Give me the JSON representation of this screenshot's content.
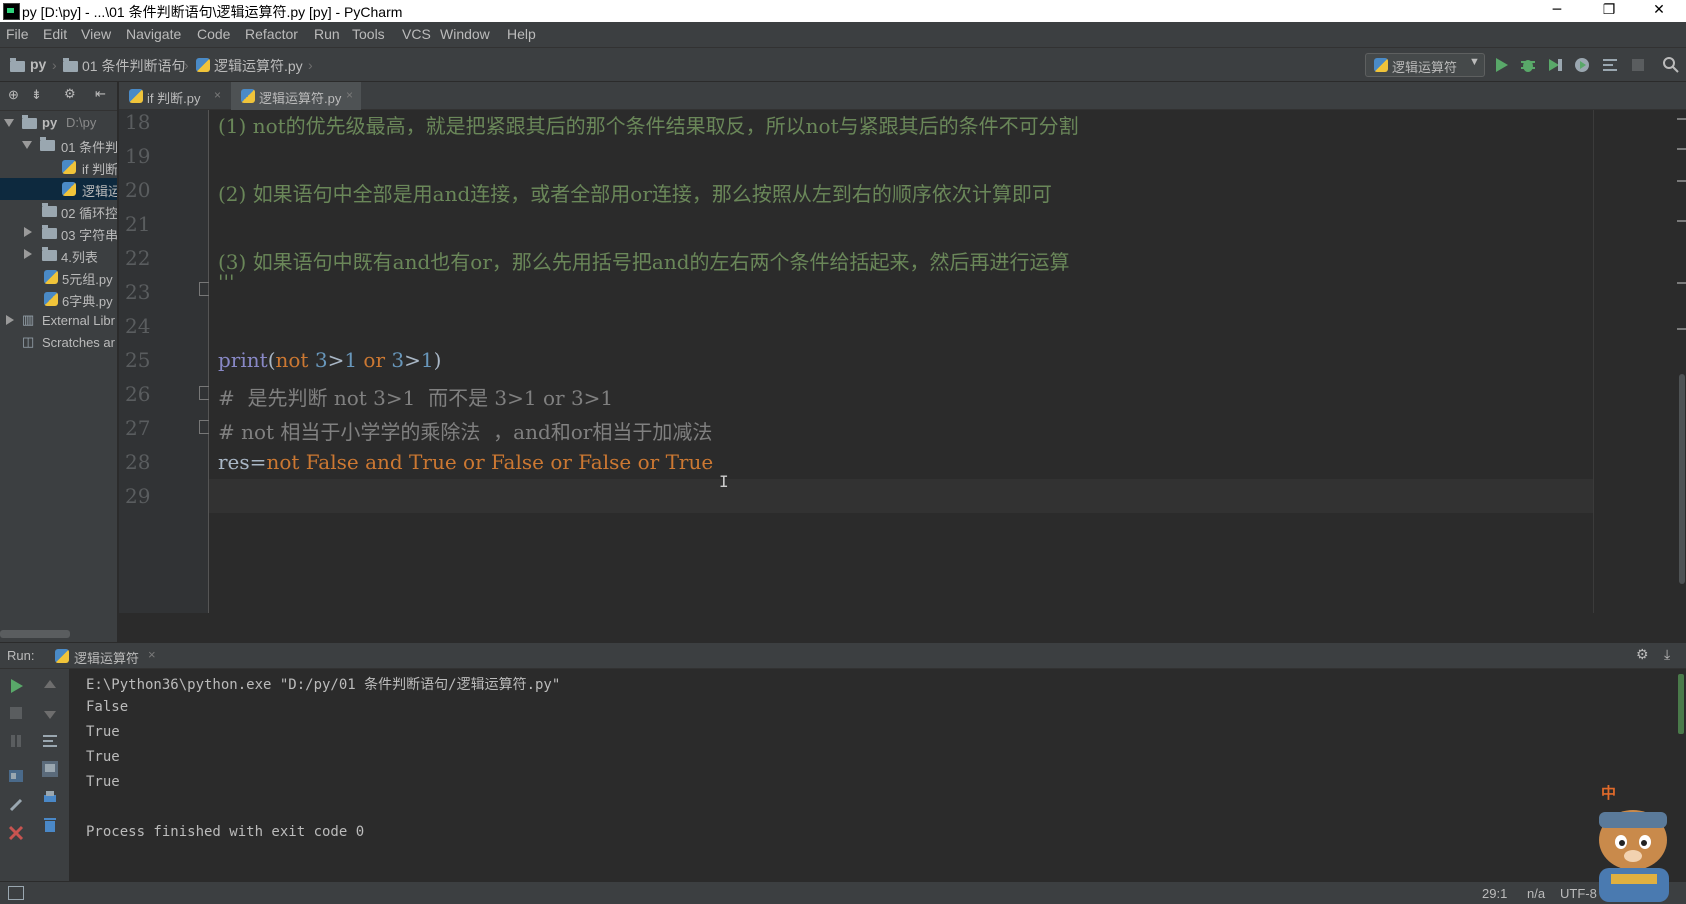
{
  "window": {
    "title": "py [D:\\py] - ...\\01 条件判断语句\\逻辑运算符.py [py] - PyCharm",
    "controls": {
      "minimize": "─",
      "restore": "❐",
      "close": "✕"
    }
  },
  "menu": [
    "File",
    "Edit",
    "View",
    "Navigate",
    "Code",
    "Refactor",
    "Run",
    "Tools",
    "VCS",
    "Window",
    "Help"
  ],
  "breadcrumbs": [
    "py",
    "01 条件判断语句",
    "逻辑运算符.py"
  ],
  "run_config": "逻辑运算符",
  "project_tree": [
    {
      "label": "py",
      "extra": "D:\\py"
    },
    {
      "label": "01 条件判"
    },
    {
      "label": "if 判断"
    },
    {
      "label": "逻辑运"
    },
    {
      "label": "02 循环控"
    },
    {
      "label": "03 字符串"
    },
    {
      "label": "4.列表"
    },
    {
      "label": "5元组.py"
    },
    {
      "label": "6字典.py"
    },
    {
      "label": "External Libr"
    },
    {
      "label": "Scratches ar"
    }
  ],
  "tabs": [
    {
      "label": "if 判断.py",
      "close": "×"
    },
    {
      "label": "逻辑运算符.py",
      "close": "×"
    }
  ],
  "editor": {
    "line_numbers": [
      "18",
      "19",
      "20",
      "21",
      "22",
      "23",
      "24",
      "25",
      "26",
      "27",
      "28",
      "29"
    ],
    "lines": [
      "(1) not的优先级最高，就是把紧跟其后的那个条件结果取反，所以not与紧跟其后的条件不可分割",
      "",
      "(2) 如果语句中全部是用and连接，或者全部用or连接，那么按照从左到右的顺序依次计算即可",
      "",
      "(3) 如果语句中既有and也有or，那么先用括号把and的左右两个条件给括起来，然后再进行运算",
      "'''",
      "",
      "print(not 3>1 or 3>1)",
      "#  是先判断 not 3>1  而不是 3>1 or 3>1",
      "# not 相当于小学学的乘除法  ，and和or相当于加减法",
      "res=not False and True or False or False or True",
      ""
    ],
    "cursor_glyph": "I"
  },
  "run": {
    "label": "Run:",
    "tab": "逻辑运算符",
    "tab_close": "×",
    "output": [
      "E:\\Python36\\python.exe \"D:/py/01 条件判断语句/逻辑运算符.py\"",
      "False",
      "True",
      "True",
      "True",
      "",
      "Process finished with exit code 0"
    ]
  },
  "status": {
    "position": "29:1",
    "separator": "n/a",
    "encoding": "UTF-8"
  },
  "overlay": {
    "ime_label": "中"
  },
  "colors": {
    "keyword": "#cc7832",
    "string": "#6a8759",
    "comment": "#808080",
    "builtin": "#8888c6",
    "number": "#6897bb",
    "accent": "#4a88c7"
  }
}
